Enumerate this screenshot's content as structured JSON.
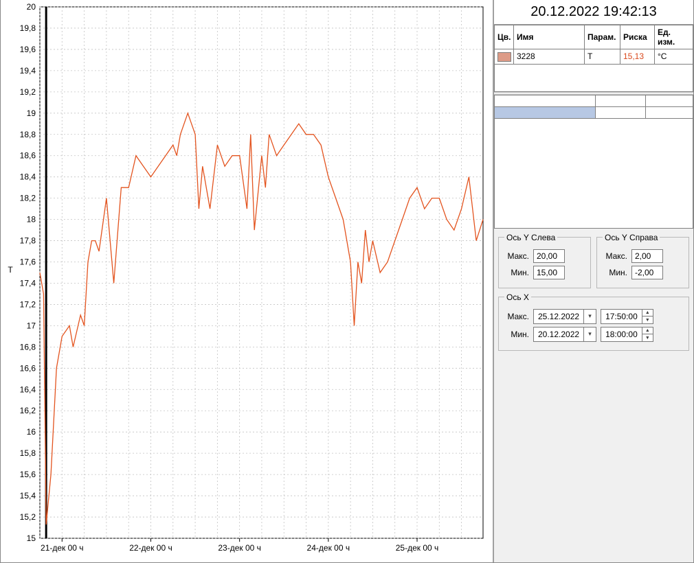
{
  "timestamp": "20.12.2022 19:42:13",
  "sensor_table": {
    "headers": {
      "color": "Цв.",
      "name": "Имя",
      "param": "Парам.",
      "mark": "Риска",
      "unit": "Ед. изм."
    },
    "rows": [
      {
        "color": "#dd9b87",
        "name": "3228",
        "param": "T",
        "mark": "15,13",
        "unit": "°C"
      }
    ]
  },
  "axis_y_left": {
    "legend": "Ось Y Слева",
    "max_label": "Макс.",
    "max": "20,00",
    "min_label": "Мин.",
    "min": "15,00"
  },
  "axis_y_right": {
    "legend": "Ось Y Справа",
    "max_label": "Макс.",
    "max": "2,00",
    "min_label": "Мин.",
    "min": "-2,00"
  },
  "axis_x": {
    "legend": "Ось X",
    "max_label": "Макс.",
    "max_date": "25.12.2022",
    "max_time": "17:50:00",
    "min_label": "Мин.",
    "min_date": "20.12.2022",
    "min_time": "18:00:00"
  },
  "chart_data": {
    "type": "line",
    "ylabel": "T",
    "ylim": [
      15,
      20
    ],
    "yticks": [
      15,
      15.2,
      15.4,
      15.6,
      15.8,
      16,
      16.2,
      16.4,
      16.6,
      16.8,
      17,
      17.2,
      17.4,
      17.6,
      17.8,
      18,
      18.2,
      18.4,
      18.6,
      18.8,
      19,
      19.2,
      19.4,
      19.6,
      19.8,
      20
    ],
    "ytick_labels": [
      "15",
      "15,2",
      "15,4",
      "15,6",
      "15,8",
      "16",
      "16,2",
      "16,4",
      "16,6",
      "16,8",
      "17",
      "17,2",
      "17,4",
      "17,6",
      "17,8",
      "18",
      "18,2",
      "18,4",
      "18,6",
      "18,8",
      "19",
      "19,2",
      "19,4",
      "19,6",
      "19,8",
      "20"
    ],
    "x_major_ticks": [
      "21-дек 00 ч",
      "22-дек 00 ч",
      "23-дек 00 ч",
      "24-дек 00 ч",
      "25-дек 00 ч"
    ],
    "x_range": [
      "20.12.2022 18:00:00",
      "25.12.2022 17:50:00"
    ],
    "cursor_x": "20.12.2022 19:42:13",
    "cursor_y": 15.13,
    "series": [
      {
        "name": "3228",
        "color": "#e3531e",
        "x": [
          "20.12 18:00",
          "20.12 19:00",
          "20.12 19:42",
          "20.12 21:00",
          "20.12 22:30",
          "21.12 00:00",
          "21.12 02:00",
          "21.12 03:00",
          "21.12 05:00",
          "21.12 06:00",
          "21.12 07:00",
          "21.12 08:00",
          "21.12 09:00",
          "21.12 10:00",
          "21.12 12:00",
          "21.12 14:00",
          "21.12 16:00",
          "21.12 18:00",
          "21.12 20:00",
          "21.12 22:00",
          "22.12 00:00",
          "22.12 02:00",
          "22.12 04:00",
          "22.12 06:00",
          "22.12 07:00",
          "22.12 08:00",
          "22.12 09:00",
          "22.12 10:00",
          "22.12 11:00",
          "22.12 12:00",
          "22.12 13:00",
          "22.12 14:00",
          "22.12 16:00",
          "22.12 18:00",
          "22.12 20:00",
          "22.12 22:00",
          "23.12 00:00",
          "23.12 02:00",
          "23.12 03:00",
          "23.12 04:00",
          "23.12 06:00",
          "23.12 07:00",
          "23.12 08:00",
          "23.12 10:00",
          "23.12 12:00",
          "23.12 14:00",
          "23.12 16:00",
          "23.12 18:00",
          "23.12 20:00",
          "23.12 22:00",
          "24.12 00:00",
          "24.12 02:00",
          "24.12 04:00",
          "24.12 06:00",
          "24.12 07:00",
          "24.12 08:00",
          "24.12 09:00",
          "24.12 10:00",
          "24.12 11:00",
          "24.12 12:00",
          "24.12 14:00",
          "24.12 16:00",
          "24.12 18:00",
          "24.12 20:00",
          "24.12 22:00",
          "25.12 00:00",
          "25.12 02:00",
          "25.12 04:00",
          "25.12 06:00",
          "25.12 08:00",
          "25.12 10:00",
          "25.12 12:00",
          "25.12 14:00",
          "25.12 16:00",
          "25.12 17:50"
        ],
        "y": [
          17.5,
          17.3,
          15.13,
          15.6,
          16.6,
          16.9,
          17.0,
          16.8,
          17.1,
          17.0,
          17.6,
          17.8,
          17.8,
          17.7,
          18.2,
          17.4,
          18.3,
          18.3,
          18.6,
          18.5,
          18.4,
          18.5,
          18.6,
          18.7,
          18.6,
          18.8,
          18.9,
          19.0,
          18.9,
          18.8,
          18.1,
          18.5,
          18.1,
          18.7,
          18.5,
          18.6,
          18.6,
          18.1,
          18.8,
          17.9,
          18.6,
          18.3,
          18.8,
          18.6,
          18.7,
          18.8,
          18.9,
          18.8,
          18.8,
          18.7,
          18.4,
          18.2,
          18.0,
          17.6,
          17.0,
          17.6,
          17.4,
          17.9,
          17.6,
          17.8,
          17.5,
          17.6,
          17.8,
          18.0,
          18.2,
          18.3,
          18.1,
          18.2,
          18.2,
          18.0,
          17.9,
          18.1,
          18.4,
          17.8,
          18.0
        ]
      }
    ]
  }
}
